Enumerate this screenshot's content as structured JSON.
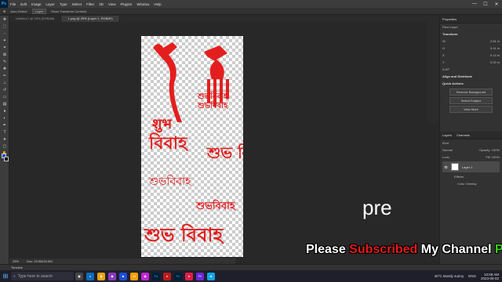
{
  "app": {
    "logo": "Ps"
  },
  "menu": [
    "File",
    "Edit",
    "Image",
    "Layer",
    "Type",
    "Select",
    "Filter",
    "3D",
    "View",
    "Plugins",
    "Window",
    "Help"
  ],
  "options": {
    "auto_select": "Auto-Select:",
    "layer": "Layer",
    "transform": "Show Transform Controls"
  },
  "tabs": [
    "Untitled-1 @ 25% (RGB/8#)",
    "1.png @ 25% (Layer 1, RGB/8*)"
  ],
  "canvas_art": {
    "a1": "शुभ",
    "a2": "বিবাহ",
    "a3": "শুভবিবাহ",
    "a4": "শুভবিবাহ",
    "a5": "শুভ বিবাহ",
    "a6": "শুভবিবাহ",
    "a7": "শুভবিবাহ",
    "a8": "শুভ বিবাহ"
  },
  "overlay": {
    "pre": "pre",
    "banner_1": "Please",
    "banner_2": "Subscribed",
    "banner_3": "My Channel",
    "banner_4": "Pre"
  },
  "status": {
    "zoom": "25%",
    "doc": "Doc: 25.9M/24.5M"
  },
  "timeline": "Timeline",
  "properties": {
    "title": "Properties",
    "kind": "Pixel Layer",
    "transform": "Transform",
    "w": "W",
    "w_val": "2.81 in",
    "h": "H",
    "h_val": "3.41 in",
    "x": "X",
    "x_val": "0.13 in",
    "y": "Y",
    "y_val": "0.00 in",
    "angle": "0.00°",
    "align": "Align and Distribute",
    "quick": "Quick Actions",
    "remove_bg": "Remove Background",
    "select_subject": "Select Subject",
    "more": "View More"
  },
  "layers": {
    "tab1": "Layers",
    "tab2": "Channels",
    "kind": "Kind",
    "mode": "Normal",
    "opacity": "Opacity: 100%",
    "lock": "Lock:",
    "fill": "Fill: 100%",
    "layer1": "Layer 1",
    "effects": "Effects",
    "overlay": "Color Overlay"
  },
  "taskbar": {
    "search": "Type here to search",
    "weather": "40°C  Mostly sunny",
    "lang": "ENG",
    "time": "10:08 AM",
    "date": "2023-06-02"
  }
}
